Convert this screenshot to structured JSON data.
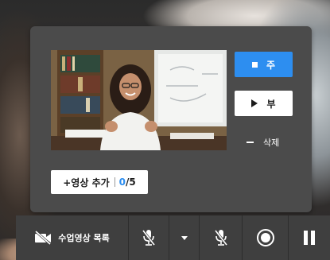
{
  "panel": {
    "primary_button_label": "주",
    "secondary_button_label": "부",
    "delete_label": "삭제",
    "add_video_label": "+영상 추가",
    "video_count_current": "0",
    "video_count_max": "/5"
  },
  "toolbar": {
    "class_video_list_label": "수업영상 목록"
  },
  "icons": {
    "main_square": "stop-square-icon",
    "play": "play-icon",
    "minus": "minus-icon",
    "video_off": "video-off-icon",
    "mic_muted": "mic-muted-icon",
    "dropdown": "caret-down-icon",
    "record": "record-icon",
    "pause": "pause-icon"
  },
  "colors": {
    "accent": "#2d8ef0",
    "panel_bg": "#4b4b4b",
    "toolbar_bg": "#3f3f3f"
  }
}
